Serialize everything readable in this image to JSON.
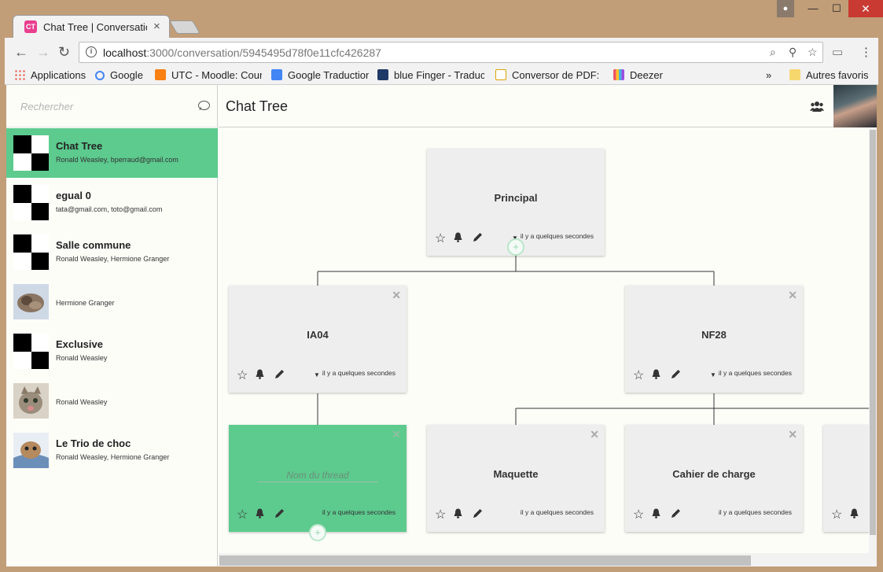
{
  "browser": {
    "tab_title": "Chat Tree | Conversation",
    "tab_favicon_text": "CT",
    "url_host": "localhost",
    "url_path": ":3000/conversation/5945495d78f0e11cfc426287",
    "bookmarks": [
      {
        "label": "Applications",
        "icon": "apps-grid-icon",
        "color": "#e94235"
      },
      {
        "label": "Google",
        "icon": "google-icon",
        "color": "#4285f4"
      },
      {
        "label": "UTC - Moodle: Cours",
        "icon": "moodle-icon",
        "color": "#f98012"
      },
      {
        "label": "Google Traduction",
        "icon": "translate-icon",
        "color": "#4285f4"
      },
      {
        "label": "blue Finger - Traduct",
        "icon": "bluefinger-icon",
        "color": "#1f3a66"
      },
      {
        "label": "Conversor de PDF: co",
        "icon": "pdf-icon",
        "color": "#d9a300"
      },
      {
        "label": "Deezer",
        "icon": "deezer-icon",
        "color": "#ef5466"
      }
    ],
    "bookmarks_more": "»",
    "other_bookmarks": "Autres favoris"
  },
  "sidebar": {
    "search_placeholder": "Rechercher",
    "conversations": [
      {
        "name": "Chat Tree",
        "members": "Ronald Weasley, bperraud@gmail.com",
        "avatar": "checker",
        "active": true
      },
      {
        "name": "egual 0",
        "members": "tata@gmail.com, toto@gmail.com",
        "avatar": "checker"
      },
      {
        "name": "Salle commune",
        "members": "Ronald Weasley, Hermione Granger",
        "avatar": "checker"
      },
      {
        "name": "",
        "members": "Hermione Granger",
        "avatar": "cat-photo"
      },
      {
        "name": "Exclusive",
        "members": "Ronald Weasley",
        "avatar": "checker"
      },
      {
        "name": "",
        "members": "Ronald Weasley",
        "avatar": "kitten-photo"
      },
      {
        "name": "Le Trio de choc",
        "members": "Ronald Weasley, Hermione Granger",
        "avatar": "kitten-blanket-photo"
      }
    ]
  },
  "header": {
    "title": "Chat Tree"
  },
  "tree": {
    "timestamp": "il y a quelques secondes",
    "new_thread_placeholder": "Nom du thread",
    "nodes": [
      {
        "name": "Principal"
      },
      {
        "name": "IA04"
      },
      {
        "name": "NF28"
      },
      {
        "name": ""
      },
      {
        "name": "Maquette"
      },
      {
        "name": "Cahier de charge"
      }
    ]
  },
  "colors": {
    "accent_green": "#5dca8e",
    "card_bg": "#eeeeee",
    "app_bg": "#fdfdf8"
  }
}
